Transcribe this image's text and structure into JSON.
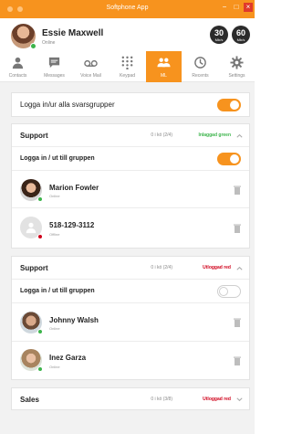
{
  "window": {
    "title": "Softphone App",
    "minimize": "−",
    "maximize": "□",
    "close": "×"
  },
  "user": {
    "name": "Essie Maxwell",
    "status": "Online"
  },
  "speeds": [
    {
      "value": "30",
      "unit": "Mb/s"
    },
    {
      "value": "60",
      "unit": "Mb/s"
    }
  ],
  "tabs": [
    {
      "label": "Contacts",
      "icon": "person-icon"
    },
    {
      "label": "Messages",
      "icon": "chat-icon"
    },
    {
      "label": "Voice Mail",
      "icon": "voicemail-icon"
    },
    {
      "label": "Keypad",
      "icon": "keypad-icon"
    },
    {
      "label": "ML",
      "icon": "group-icon",
      "active": true
    },
    {
      "label": "Recents",
      "icon": "history-icon"
    },
    {
      "label": "Settings",
      "icon": "gear-icon"
    }
  ],
  "global_toggle": {
    "label": "Logga in/ur alla svarsgrupper",
    "on": true
  },
  "groups": [
    {
      "name": "Support",
      "queue": "0 i kö (2/4)",
      "state": "Inlaggad green",
      "state_color": "#3cb44b",
      "toggle_label": "Logga in / ut till gruppen",
      "toggle_on": true,
      "members": [
        {
          "name": "Marion Fowler",
          "status": "Online"
        },
        {
          "name": "518-129-3112",
          "status": "Offline"
        }
      ]
    },
    {
      "name": "Support",
      "queue": "0 i kö (2/4)",
      "state": "Utloggad red",
      "state_color": "#d0021b",
      "toggle_label": "Logga in / ut till gruppen",
      "toggle_on": false,
      "members": [
        {
          "name": "Johnny Walsh",
          "status": "Online"
        },
        {
          "name": "Inez Garza",
          "status": "Online"
        }
      ]
    },
    {
      "name": "Sales",
      "queue": "0 i kö (3/8)",
      "state": "Utloggad red",
      "state_color": "#d0021b"
    }
  ],
  "colors": {
    "accent": "#f7931e",
    "online": "#3cb44b",
    "offline": "#d0021b"
  }
}
